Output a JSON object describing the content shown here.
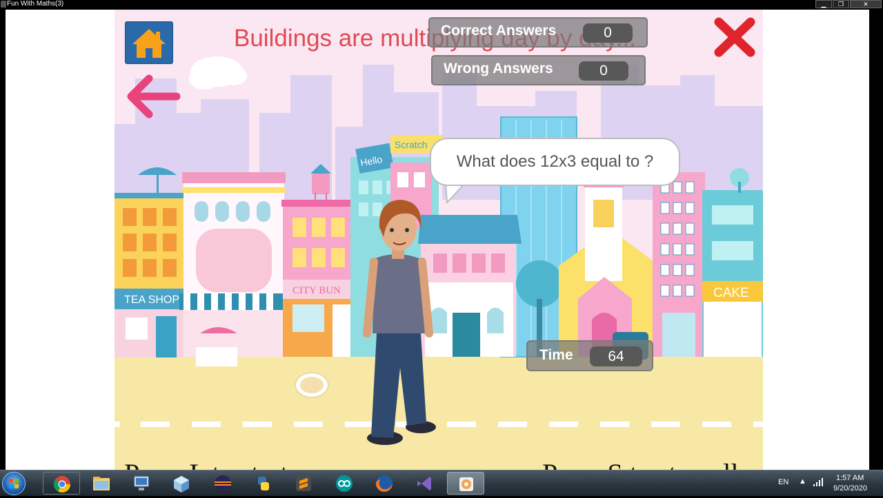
{
  "window": {
    "title": "Fun With Maths(3)",
    "minimize_symbol": "▁",
    "restore_symbol": "❐",
    "close_symbol": "✕"
  },
  "game": {
    "message": "Buildings are multiplying day by day...",
    "correct_label": "Correct Answers",
    "correct_value": "0",
    "wrong_label": "Wrong Answers",
    "wrong_value": "0",
    "question": "What does 12x3 equal to ?",
    "time_label": "Time",
    "time_value": "64",
    "bottom_left": "Press L to start",
    "bottom_right": "Press S to stop all",
    "signs": {
      "tea_shop": "TEA SHOP",
      "city_bun": "CITY BUN",
      "cake": "CAKE",
      "hello": "Hello",
      "scratch": "Scratch"
    },
    "icons": [
      "home-icon",
      "back-arrow-icon",
      "close-icon"
    ]
  },
  "colors": {
    "message": "#e04a55",
    "home_button": "#2a6aa8",
    "close": "#e0242d",
    "back_arrow": "#e8437a"
  },
  "taskbar": {
    "items": [
      {
        "name": "chrome-icon"
      },
      {
        "name": "file-explorer-icon"
      },
      {
        "name": "network-computer-icon"
      },
      {
        "name": "3d-box-icon"
      },
      {
        "name": "eclipse-icon"
      },
      {
        "name": "python-icon"
      },
      {
        "name": "sublime-text-icon"
      },
      {
        "name": "arduino-icon"
      },
      {
        "name": "firefox-icon"
      },
      {
        "name": "visual-studio-icon"
      },
      {
        "name": "scratch-app-icon",
        "active": true
      }
    ],
    "language": "EN",
    "time": "1:57 AM",
    "date": "9/20/2020"
  }
}
